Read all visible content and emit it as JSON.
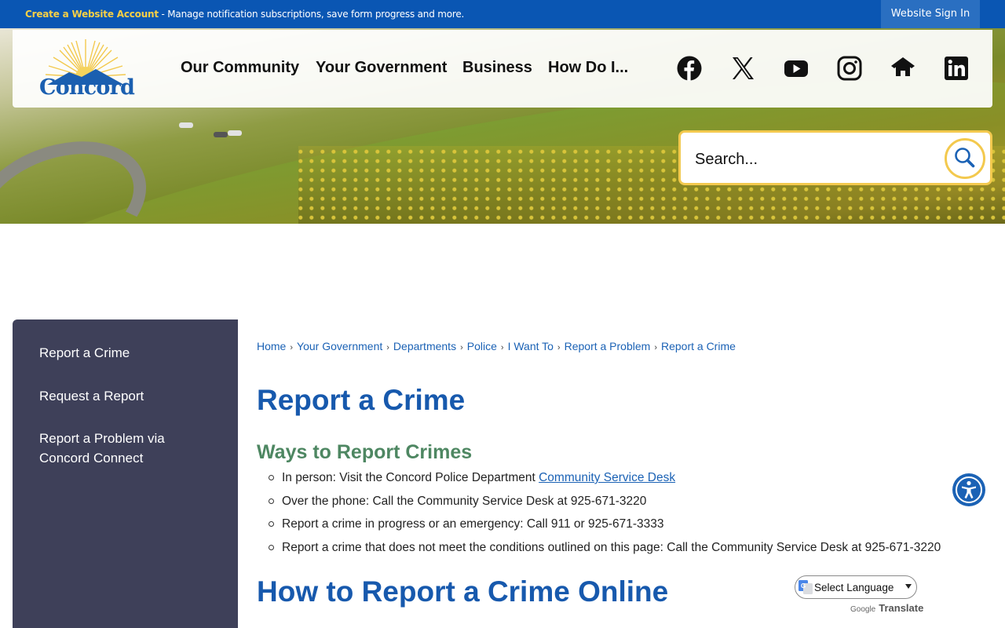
{
  "topbar": {
    "create_link": "Create a Website Account",
    "message": " - Manage notification subscriptions, save form progress and more.",
    "signin_label": "Website Sign In"
  },
  "logo": {
    "text": "Concord"
  },
  "nav": {
    "items": [
      {
        "label": "Our Community"
      },
      {
        "label": "Your Government"
      },
      {
        "label": "Business"
      },
      {
        "label": "How Do I..."
      }
    ]
  },
  "social": [
    "facebook-icon",
    "x-icon",
    "youtube-icon",
    "instagram-icon",
    "nextdoor-icon",
    "linkedin-icon"
  ],
  "search": {
    "placeholder": "Search..."
  },
  "sidebar": {
    "items": [
      {
        "label": "Report a Crime"
      },
      {
        "label": "Request a Report"
      },
      {
        "label": "Report a Problem via Concord Connect"
      }
    ]
  },
  "breadcrumb": {
    "items": [
      "Home",
      "Your Government",
      "Departments",
      "Police",
      "I Want To",
      "Report a Problem",
      "Report a Crime"
    ]
  },
  "main": {
    "title": "Report a Crime",
    "subtitle": "Ways to Report Crimes",
    "bullets": [
      {
        "text": "In person: Visit the Concord Police Department ",
        "link": "Community Service Desk"
      },
      {
        "text": "Over the phone: Call the Community Service Desk at 925-671-3220"
      },
      {
        "text": "Report a crime in progress or an emergency: Call 911 or 925-671-3333"
      },
      {
        "text": "Report a crime that does not meet the conditions outlined on this page: Call the Community Service Desk at 925-671-3220"
      }
    ],
    "section_title": "How to Report a Crime Online"
  },
  "translate": {
    "select_label": "Select Language",
    "powered_prefix": "Google",
    "powered_word": "Translate"
  },
  "colors": {
    "topbar": "#0a56b3",
    "accent_yellow": "#f3c94e",
    "link_blue": "#1b62b5",
    "heading_blue": "#1759ad",
    "heading_green": "#4e8762",
    "sidebar_bg": "#3e4059"
  }
}
